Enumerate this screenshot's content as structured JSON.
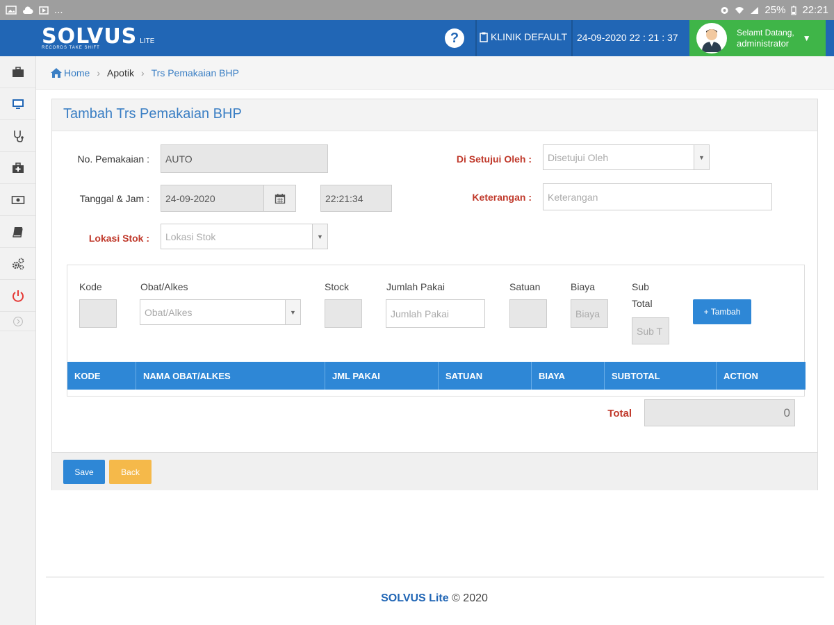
{
  "status_bar": {
    "left_icons": [
      "image-icon",
      "cloud-icon",
      "media-icon"
    ],
    "ellipsis": "...",
    "battery": "25%",
    "time": "22:21"
  },
  "header": {
    "brand_name": "SOLVUS",
    "brand_suffix": "LITE",
    "brand_tagline": "RECORDS TAKE SHIFT",
    "clinic": "KLINIK DEFAULT",
    "datetime": "24-09-2020 22 : 21 : 37",
    "greeting": "Selamt Datang,",
    "username": "administrator",
    "colors": {
      "primary": "#2166b5",
      "user_bg": "#3fb548"
    }
  },
  "sidebar": {
    "items": [
      "briefcase-icon",
      "monitor-icon",
      "stethoscope-icon",
      "medkit-icon",
      "money-icon",
      "book-icon",
      "cogs-icon",
      "power-icon",
      "expand-icon"
    ]
  },
  "breadcrumb": {
    "home": "Home",
    "section": "Apotik",
    "current": "Trs Pemakaian BHP"
  },
  "form": {
    "title": "Tambah Trs Pemakaian BHP",
    "no_pemakaian_label": "No. Pemakaian :",
    "no_pemakaian_value": "AUTO",
    "tanggal_label": "Tanggal & Jam :",
    "tanggal_value": "24-09-2020",
    "jam_value": "22:21:34",
    "lokasi_label": "Lokasi Stok :",
    "lokasi_placeholder": "Lokasi Stok",
    "disetujui_label": "Di Setujui Oleh :",
    "disetujui_placeholder": "Disetujui Oleh",
    "keterangan_label": "Keterangan :",
    "keterangan_placeholder": "Keterangan"
  },
  "items": {
    "kode_label": "Kode",
    "obat_label": "Obat/Alkes",
    "obat_placeholder": "Obat/Alkes",
    "stock_label": "Stock",
    "jumlah_label": "Jumlah Pakai",
    "jumlah_placeholder": "Jumlah Pakai",
    "satuan_label": "Satuan",
    "biaya_label": "Biaya",
    "biaya_placeholder": "Biaya",
    "subtotal_label_1": "Sub",
    "subtotal_label_2": "Total",
    "subtotal_placeholder": "Sub T",
    "tambah_button": "+ Tambah",
    "columns": [
      "KODE",
      "NAMA OBAT/ALKES",
      "JML PAKAI",
      "SATUAN",
      "BIAYA",
      "SUBTOTAL",
      "ACTION"
    ],
    "total_label": "Total",
    "total_value": "0"
  },
  "actions": {
    "save": "Save",
    "back": "Back"
  },
  "footer": {
    "brand": "SOLVUS Lite",
    "copyright": "© 2020"
  }
}
